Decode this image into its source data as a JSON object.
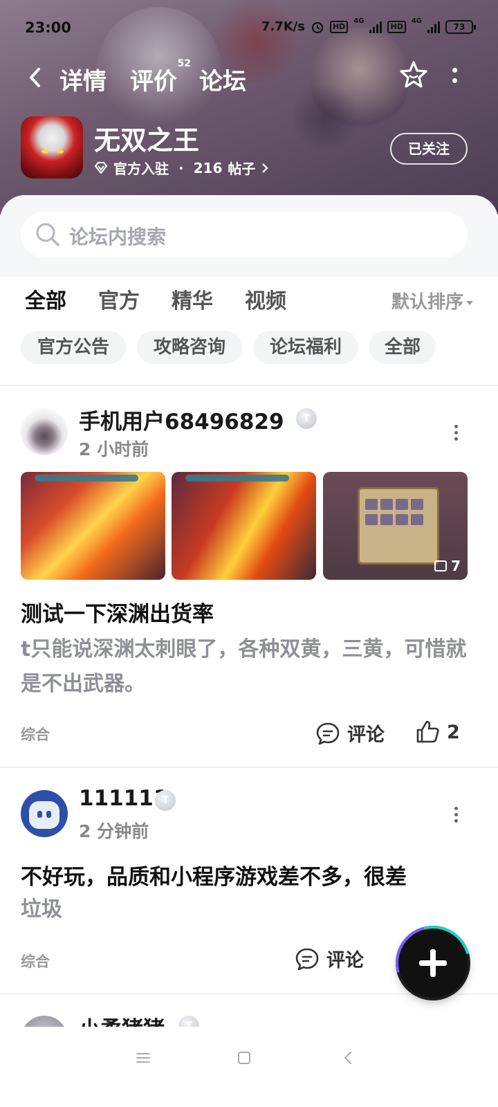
{
  "status_bar": {
    "time": "23:00",
    "network_speed": "7.7K/s",
    "hd1": "HD",
    "net1": "4G",
    "hd2": "HD",
    "net2": "4G",
    "battery": "73"
  },
  "nav": {
    "tabs": [
      {
        "label": "详情",
        "active": false
      },
      {
        "label": "评价",
        "active": false,
        "count": "52"
      },
      {
        "label": "论坛",
        "active": true
      }
    ]
  },
  "app": {
    "name": "无双之王",
    "official_label": "官方入驻",
    "separator": "·",
    "post_count": "216",
    "post_count_label": "帖子",
    "follow_button": "已关注"
  },
  "search": {
    "placeholder": "论坛内搜索"
  },
  "filter_tabs": {
    "items": [
      {
        "label": "全部",
        "active": true
      },
      {
        "label": "官方",
        "active": false
      },
      {
        "label": "精华",
        "active": false
      },
      {
        "label": "视频",
        "active": false
      }
    ],
    "sort_label": "默认排序"
  },
  "chips": [
    "官方公告",
    "攻略咨询",
    "论坛福利",
    "全部"
  ],
  "posts": [
    {
      "username": "手机用户68496829",
      "level_badge": "T",
      "time": "2 小时前",
      "image_count": "7",
      "title": "测试一下深渊出货率",
      "body": "t只能说深渊太刺眼了，各种双黄，三黄，可惜就是不出武器。",
      "category": "综合",
      "comment_label": "评论",
      "like_count": "2"
    },
    {
      "username": "111111",
      "level_badge": "T",
      "time": "2 分钟前",
      "title": "不好玩，品质和小程序游戏差不多，很差",
      "body": "垃圾",
      "category": "综合",
      "comment_label": "评论"
    },
    {
      "username": "小柔猪猪",
      "level_badge": "T"
    }
  ],
  "colors": {
    "accent": "#1fd3c6",
    "banner": "#6e5a6e"
  }
}
